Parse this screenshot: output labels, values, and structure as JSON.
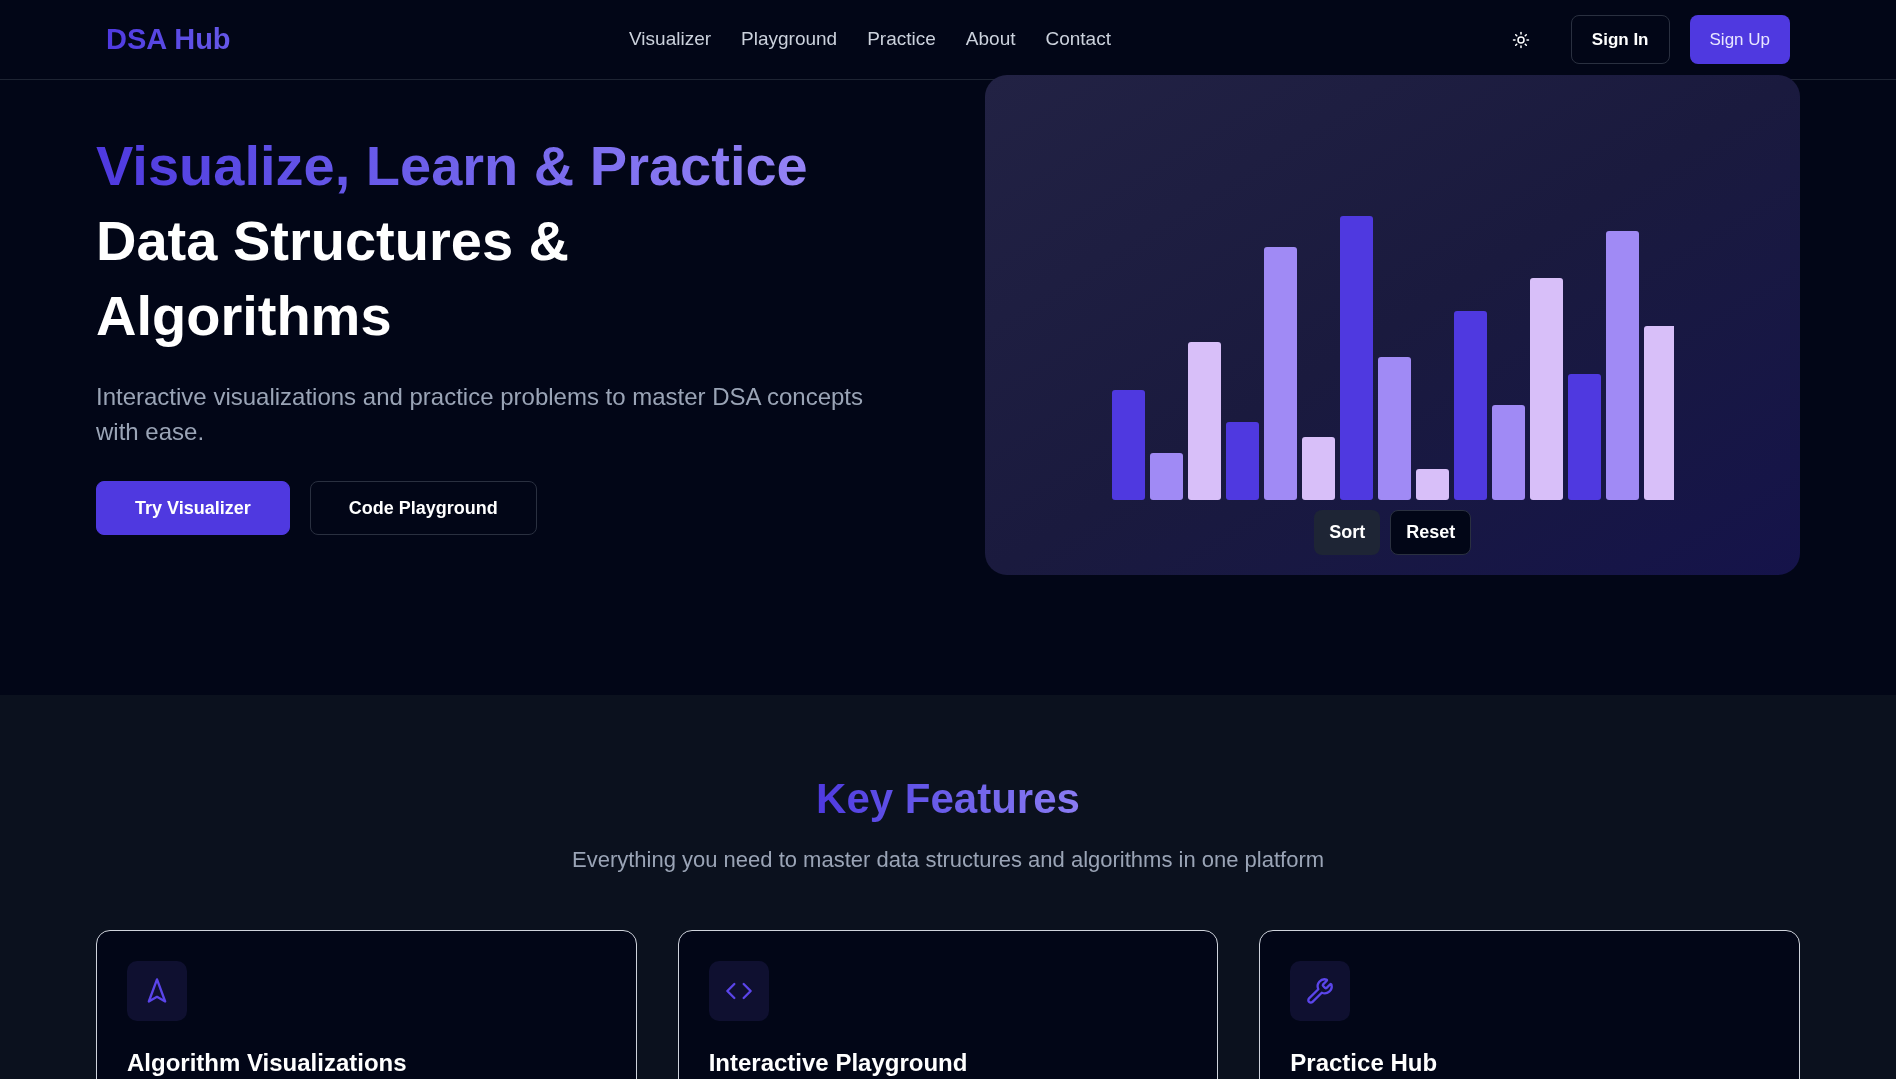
{
  "header": {
    "logo": "DSA Hub",
    "nav": [
      "Visualizer",
      "Playground",
      "Practice",
      "About",
      "Contact"
    ],
    "sign_in": "Sign In",
    "sign_up": "Sign Up"
  },
  "hero": {
    "title_highlight": "Visualize, Learn & Practice",
    "title_rest": "Data Structures & Algorithms",
    "subtitle": "Interactive visualizations and practice problems to master DSA concepts with ease.",
    "buttons": [
      {
        "label": "Try Visualizer",
        "kind": "primary"
      },
      {
        "label": "Code Playground",
        "kind": "outline"
      }
    ]
  },
  "visualizer": {
    "buttons": [
      {
        "label": "Sort",
        "kind": "muted"
      },
      {
        "label": "Reset",
        "kind": "dark"
      }
    ]
  },
  "features": {
    "title": "Key Features",
    "subtitle": "Everything you need to master data structures and algorithms in one platform",
    "cards": [
      {
        "title": "Algorithm Visualizations"
      },
      {
        "title": "Interactive Playground"
      },
      {
        "title": "Practice Hub"
      }
    ]
  }
}
